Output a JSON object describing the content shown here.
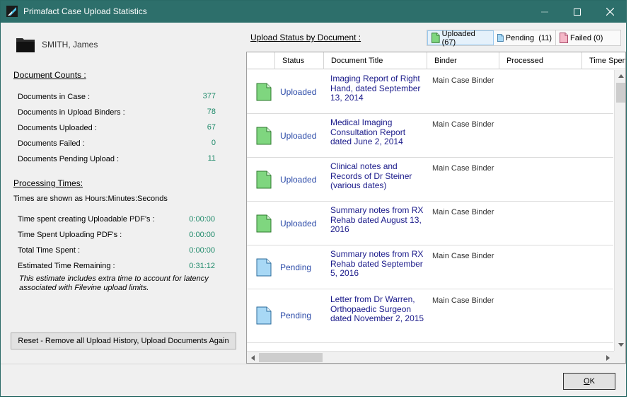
{
  "window": {
    "title": "Primafact Case Upload Statistics",
    "accent_color": "#2d6f6b"
  },
  "client": {
    "name": "SMITH, James",
    "icon": "folder-icon"
  },
  "document_counts": {
    "heading": "Document Counts :",
    "items": [
      {
        "label": "Documents in Case :",
        "value": "377"
      },
      {
        "label": "Documents in Upload Binders :",
        "value": "78"
      },
      {
        "label": "Documents Uploaded :",
        "value": "67"
      },
      {
        "label": "Documents Failed :",
        "value": "0"
      },
      {
        "label": "Documents Pending Upload :",
        "value": "11"
      }
    ]
  },
  "processing_times": {
    "heading": "Processing Times:",
    "format_note": "Times are shown as Hours:Minutes:Seconds",
    "items": [
      {
        "label": "Time spent creating Uploadable PDF's :",
        "value": "0:00:00"
      },
      {
        "label": "Time Spent Uploading PDF's :",
        "value": "0:00:00"
      },
      {
        "label": "Total Time Spent :",
        "value": "0:00:00"
      },
      {
        "label": "Estimated Time Remaining :",
        "value": "0:31:12"
      }
    ],
    "estimate_note": "This estimate includes extra time to account for latency associated with Filevine upload limits."
  },
  "reset_button_label": "Reset - Remove all Upload History, Upload Documents Again",
  "upload_status": {
    "heading": "Upload Status by Document :",
    "tabs": [
      {
        "label": "Uploaded (67)",
        "icon": "doc-green-icon",
        "active": true
      },
      {
        "label": "Pending  (11)",
        "icon": "doc-blue-icon",
        "active": false
      },
      {
        "label": "Failed (0)",
        "icon": "doc-pink-icon",
        "active": false
      }
    ],
    "columns": [
      "Status",
      "Document Title",
      "Binder",
      "Processed",
      "Time Spent"
    ],
    "rows": [
      {
        "status": "Uploaded",
        "title": "Imaging Report of Right Hand, dated September 13, 2014",
        "binder": "Main Case Binder",
        "icon": "doc-green-icon"
      },
      {
        "status": "Uploaded",
        "title": "Medical Imaging Consultation Report dated June 2, 2014",
        "binder": "Main Case Binder",
        "icon": "doc-green-icon"
      },
      {
        "status": "Uploaded",
        "title": "Clinical notes and Records of Dr Steiner (various dates)",
        "binder": "Main Case Binder",
        "icon": "doc-green-icon"
      },
      {
        "status": "Uploaded",
        "title": "Summary notes from RX Rehab dated August 13, 2016",
        "binder": "Main Case Binder",
        "icon": "doc-green-icon"
      },
      {
        "status": "Pending",
        "title": "Summary notes from RX Rehab dated September 5, 2016",
        "binder": "Main Case Binder",
        "icon": "doc-blue-icon"
      },
      {
        "status": "Pending",
        "title": "Letter from Dr Warren, Orthopaedic Surgeon dated November 2, 2015",
        "binder": "Main Case Binder",
        "icon": "doc-blue-icon"
      }
    ],
    "colors": {
      "uploaded": "#7fd67f",
      "pending": "#a8d8f5",
      "failed": "#f5b8c8"
    }
  },
  "ok_button": {
    "label_underlined": "O",
    "label_rest": "K"
  }
}
